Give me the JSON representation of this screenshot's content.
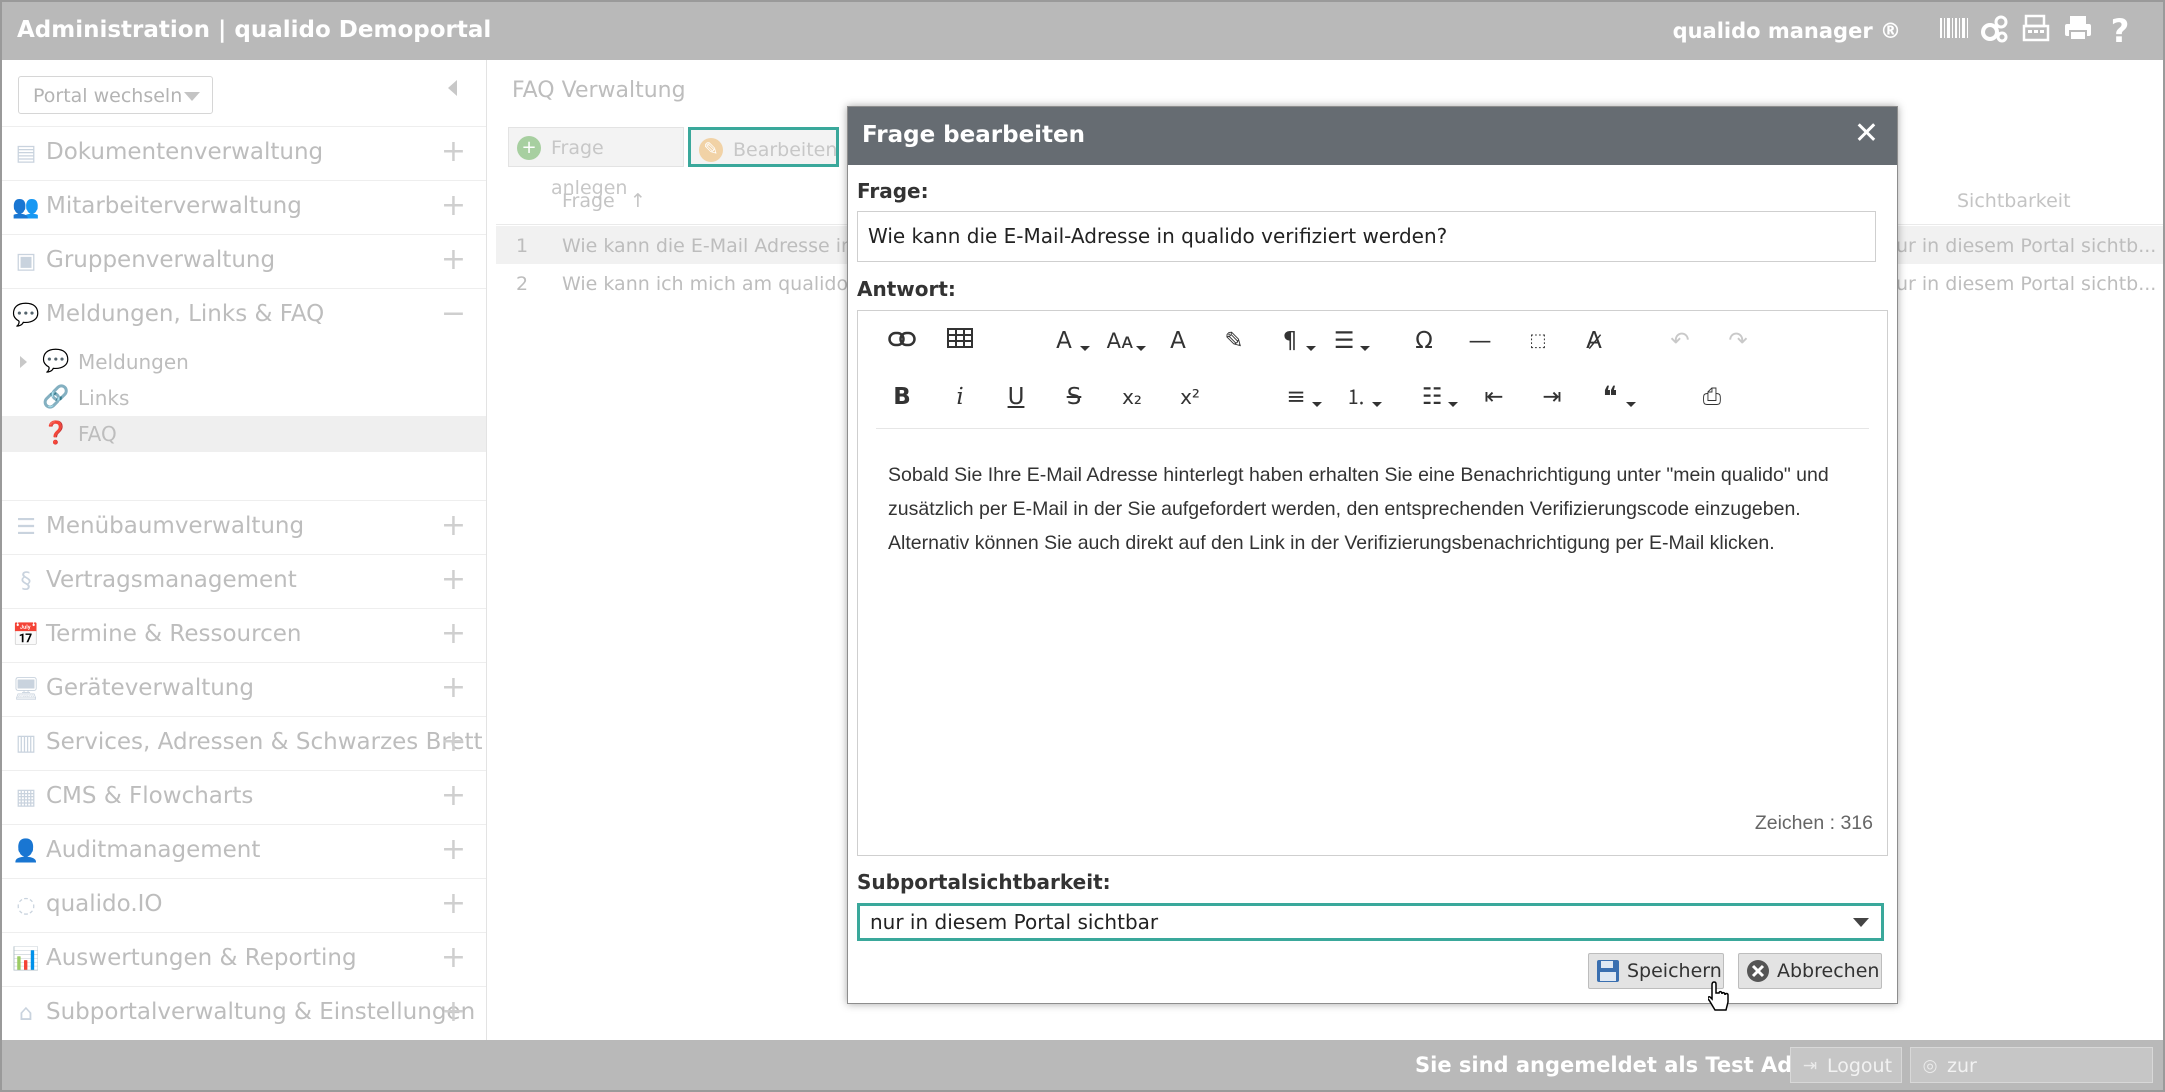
{
  "topbar": {
    "title": "Administration | qualido Demoportal",
    "brand": "qualido manager ®",
    "icons": [
      "barcode-icon",
      "gears-icon",
      "fax-icon",
      "print-icon",
      "help-icon"
    ]
  },
  "sidebar": {
    "portal_select": "Portal wechseln",
    "items": [
      {
        "label": "Dokumentenverwaltung",
        "icon": "documents-icon",
        "toggle": "+"
      },
      {
        "label": "Mitarbeiterverwaltung",
        "icon": "users-icon",
        "toggle": "+"
      },
      {
        "label": "Gruppenverwaltung",
        "icon": "group-icon",
        "toggle": "+"
      },
      {
        "label": "Meldungen, Links & FAQ",
        "icon": "chat-icon",
        "toggle": "−"
      },
      {
        "label": "Menübaumverwaltung",
        "icon": "list-icon",
        "toggle": "+"
      },
      {
        "label": "Vertragsmanagement",
        "icon": "paragraph-icon",
        "toggle": "+"
      },
      {
        "label": "Termine & Ressourcen",
        "icon": "calendar-icon",
        "toggle": "+"
      },
      {
        "label": "Geräteverwaltung",
        "icon": "device-icon",
        "toggle": "+"
      },
      {
        "label": "Services, Adressen & Schwarzes Brett",
        "icon": "board-icon",
        "toggle": "+"
      },
      {
        "label": "CMS & Flowcharts",
        "icon": "cms-icon",
        "toggle": "+"
      },
      {
        "label": "Auditmanagement",
        "icon": "auditor-icon",
        "toggle": "+"
      },
      {
        "label": "qualido.IO",
        "icon": "io-icon",
        "toggle": "+"
      },
      {
        "label": "Auswertungen & Reporting",
        "icon": "chart-icon",
        "toggle": "+"
      },
      {
        "label": "Subportalverwaltung & Einstellungen",
        "icon": "home-icon",
        "toggle": "+"
      }
    ],
    "sub_items": [
      {
        "label": "Meldungen",
        "icon": "chat-icon"
      },
      {
        "label": "Links",
        "icon": "link-icon"
      },
      {
        "label": "FAQ",
        "icon": "question-icon"
      }
    ]
  },
  "main": {
    "title": "FAQ Verwaltung",
    "toolbar": {
      "add_label": "Frage anlegen",
      "edit_label": "Bearbeiten"
    },
    "columns": {
      "question": "Frage",
      "visibility": "Sichtbarkeit"
    },
    "rows": [
      {
        "num": "1",
        "question": "Wie kann die E-Mail Adresse in",
        "visibility": "ur in diesem Portal sichtb..."
      },
      {
        "num": "2",
        "question": "Wie kann ich mich am qualido",
        "visibility": "ur in diesem Portal sichtb..."
      }
    ]
  },
  "modal": {
    "title": "Frage bearbeiten",
    "close": "✕",
    "question_label": "Frage:",
    "question_value": "Wie kann die E-Mail-Adresse in qualido verifiziert werden?",
    "answer_label": "Antwort:",
    "answer_text": "Sobald Sie Ihre E-Mail Adresse hinterlegt haben erhalten Sie eine Benachrichtigung unter \"mein qualido\" und zusätzlich per E-Mail in der Sie aufgefordert werden, den entsprechenden Verifizierungscode einzugeben. Alternativ können Sie auch direkt auf den Link in der Verifizierungsbenachrichtigung per E-Mail klicken.",
    "char_count": "Zeichen : 316",
    "visibility_label": "Subportalsichtbarkeit:",
    "visibility_value": "nur in diesem Portal sichtbar",
    "save_label": "Speichern",
    "cancel_label": "Abbrechen"
  },
  "bottombar": {
    "login_text": "Sie sind angemeldet als Test Admin",
    "logout_label": "Logout",
    "employee_view_label": "zur Mitarbeiteransicht"
  },
  "colors": {
    "topbar": "#b9b9b9",
    "modal_header": "#666c72",
    "accent_focus": "#3aa89b"
  }
}
